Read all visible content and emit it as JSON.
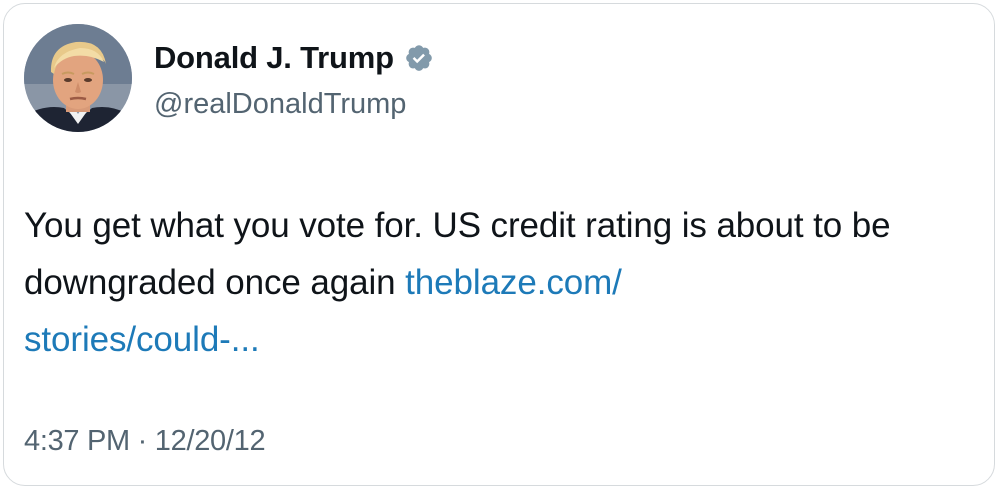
{
  "author": {
    "display_name": "Donald J. Trump",
    "handle": "@realDonaldTrump",
    "verified_icon": "verified-badge-icon",
    "avatar_icon": "profile-photo"
  },
  "tweet": {
    "text_before_link": "You get what you vote for.  US credit rating is about to be downgraded once again ",
    "link_part1": "theblaze.com/",
    "link_part2": "stories/could-..."
  },
  "meta": {
    "time": "4:37 PM",
    "separator": "·",
    "date": "12/20/12"
  },
  "colors": {
    "text": "#0f1419",
    "secondary": "#536471",
    "link": "#1d7ab8",
    "badge": "#829aab"
  }
}
